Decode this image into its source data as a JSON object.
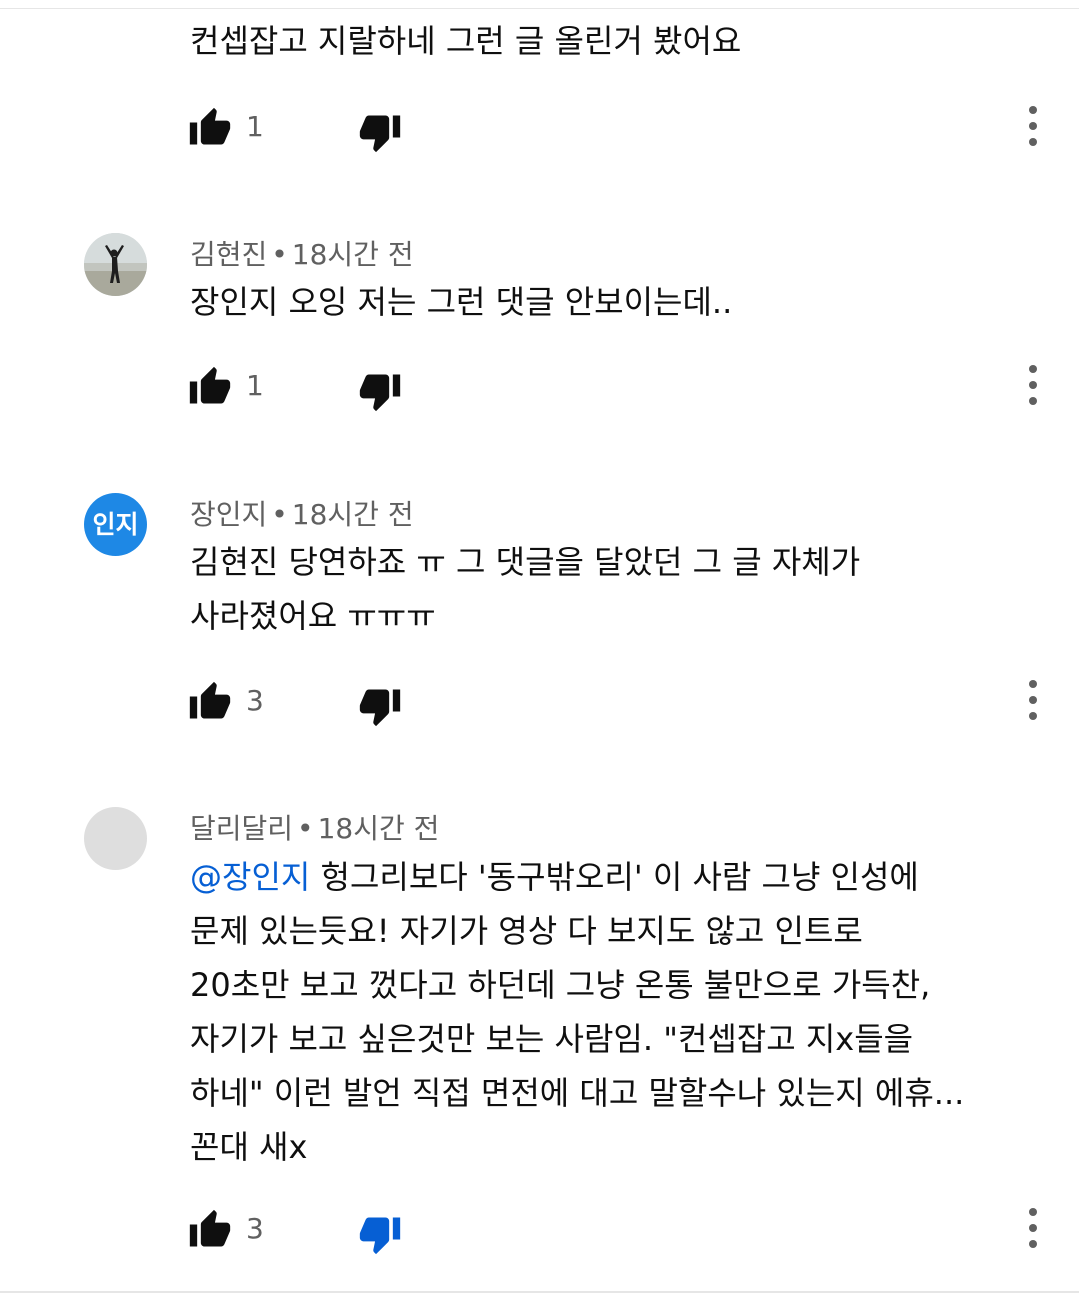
{
  "comments": [
    {
      "author": "",
      "time": "",
      "text": "컨셉잡고 지랄하네 그런 글 올린거 봤어요",
      "mention": "",
      "likes": "1",
      "disliked": false,
      "avatar": "none"
    },
    {
      "author": "김현진",
      "time": "18시간 전",
      "text": "장인지 오잉 저는 그런 댓글 안보이는데..",
      "mention": "",
      "likes": "1",
      "disliked": false,
      "avatar": "photo"
    },
    {
      "author": "장인지",
      "time": "18시간 전",
      "text": "김현진 당연하죠 ㅠ 그 댓글을 달았던 그 글 자체가\n사라졌어요 ㅠㅠㅠ",
      "mention": "",
      "likes": "3",
      "disliked": false,
      "avatar": "initials",
      "avatar_initials": "인지"
    },
    {
      "author": "달리달리",
      "time": "18시간 전",
      "mention": "@장인지",
      "text": " 헝그리보다 '동구밖오리' 이 사람 그냥 인성에\n문제 있는듯요! 자기가 영상 다 보지도 않고 인트로\n20초만 보고 껐다고 하던데 그냥 온통 불만으로 가득찬,\n자기가 보고 싶은것만 보는 사람임. \"컨셉잡고 지x들을\n하네\" 이런 발언 직접 면전에 대고 말할수나 있는지 에휴...\n꼰대 새x",
      "likes": "3",
      "disliked": true,
      "avatar": "blank"
    }
  ],
  "colors": {
    "icon": "#0f0f0f",
    "meta_text": "#606060",
    "mention": "#065fd4",
    "dislike_active": "#065fd4",
    "avatar_initials_bg": "#1e88e5",
    "avatar_blank_bg": "#dedede"
  },
  "icons": {
    "like": "thumbs-up-icon",
    "dislike": "thumbs-down-icon",
    "more": "more-vert-icon"
  }
}
